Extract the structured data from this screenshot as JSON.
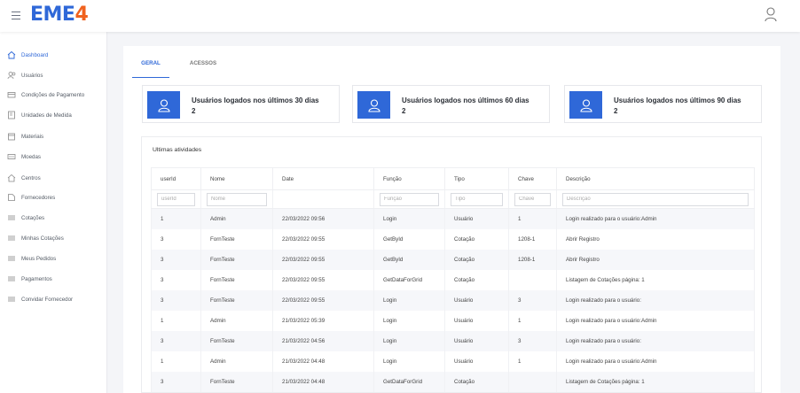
{
  "app": {
    "logo_main": "EME",
    "logo_accent": "4"
  },
  "sidebar": {
    "items": [
      {
        "label": "Dashboard",
        "icon": "home-icon",
        "active": true
      },
      {
        "label": "Usuários",
        "icon": "users-icon"
      },
      {
        "label": "Condições de Pagamento",
        "icon": "payment-card-icon"
      },
      {
        "label": "Unidades de Medida",
        "icon": "ruler-icon"
      },
      {
        "label": "Materiais",
        "icon": "box-icon"
      },
      {
        "label": "Moedas",
        "icon": "money-icon"
      },
      {
        "label": "Centros",
        "icon": "building-icon"
      },
      {
        "label": "Fornecedores",
        "icon": "truck-icon"
      },
      {
        "label": "Cotações",
        "icon": "list-icon"
      },
      {
        "label": "Minhas Cotações",
        "icon": "list-icon"
      },
      {
        "label": "Meus Pedidos",
        "icon": "list-icon"
      },
      {
        "label": "Pagamentos",
        "icon": "list-icon"
      },
      {
        "label": "Convidar Fornecedor",
        "icon": "list-icon"
      }
    ]
  },
  "tabs": [
    {
      "label": "GERAL",
      "active": true
    },
    {
      "label": "ACESSOS"
    }
  ],
  "cards": [
    {
      "title": "Usuários logados nos últimos 30 dias",
      "count": "2"
    },
    {
      "title": "Usuários logados nos últimos 60 dias",
      "count": "2"
    },
    {
      "title": "Usuários logados nos últimos 90 dias",
      "count": "2"
    }
  ],
  "activity": {
    "title": "Ultimas atividades",
    "columns": [
      "userId",
      "Nome",
      "Date",
      "Função",
      "Tipo",
      "Chave",
      "Descrição"
    ],
    "filters": [
      "userId",
      "Nome",
      "",
      "Função",
      "Tipo",
      "Chave",
      "Descrição"
    ],
    "rows": [
      [
        "1",
        "Admin",
        "22/03/2022 09:56",
        "Login",
        "Usuário",
        "1",
        "Login realizado para o usuário:Admin"
      ],
      [
        "3",
        "FornTeste",
        "22/03/2022 09:55",
        "GetById",
        "Cotação",
        "1208-1",
        "Abrir Registro"
      ],
      [
        "3",
        "FornTeste",
        "22/03/2022 09:55",
        "GetById",
        "Cotação",
        "1208-1",
        "Abrir Registro"
      ],
      [
        "3",
        "FornTeste",
        "22/03/2022 09:55",
        "GetDataForGrid",
        "Cotação",
        "",
        "Listagem de Cotações página: 1"
      ],
      [
        "3",
        "FornTeste",
        "22/03/2022 09:55",
        "Login",
        "Usuário",
        "3",
        "Login realizado para o usuário:"
      ],
      [
        "1",
        "Admin",
        "21/03/2022 05:39",
        "Login",
        "Usuário",
        "1",
        "Login realizado para o usuário:Admin"
      ],
      [
        "3",
        "FornTeste",
        "21/03/2022 04:56",
        "Login",
        "Usuário",
        "3",
        "Login realizado para o usuário:"
      ],
      [
        "1",
        "Admin",
        "21/03/2022 04:48",
        "Login",
        "Usuário",
        "1",
        "Login realizado para o usuário:Admin"
      ],
      [
        "3",
        "FornTeste",
        "21/03/2022 04:48",
        "GetDataForGrid",
        "Cotação",
        "",
        "Listagem de Cotações página: 1"
      ]
    ]
  },
  "colors": {
    "primary": "#2f68d8",
    "logo_accent": "#f0621e"
  }
}
